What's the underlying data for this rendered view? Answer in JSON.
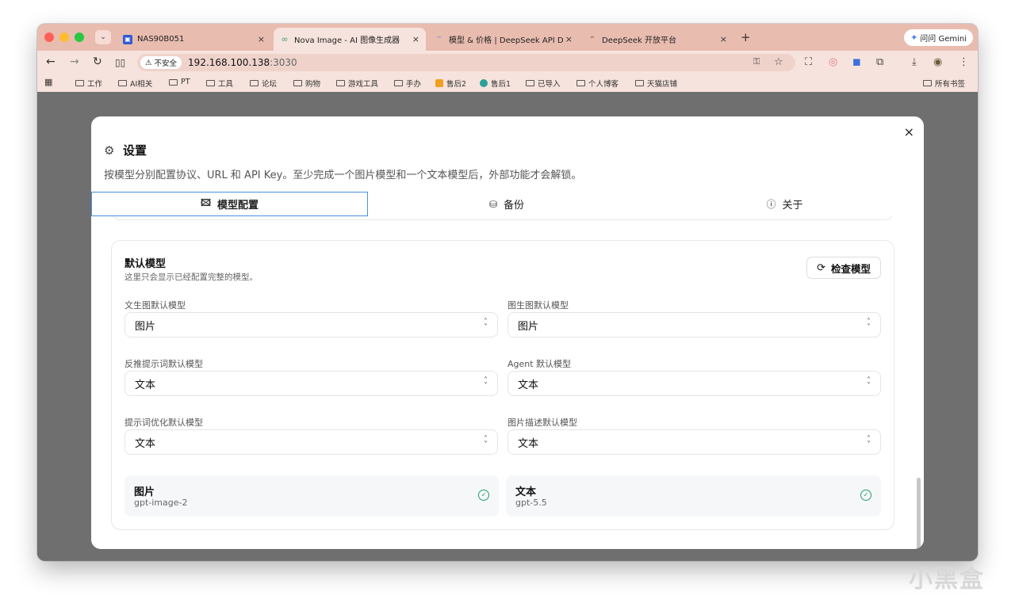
{
  "browser": {
    "tabs": [
      {
        "label": "NAS90B051",
        "color": "#2f5bd3",
        "icon": "nas-icon"
      },
      {
        "label": "Nova Image - AI 图像生成器",
        "color": "#3aa66a",
        "icon": "nova-icon"
      },
      {
        "label": "模型 & 价格 | DeepSeek API D",
        "color": "#4d6bfe",
        "icon": "deepseek-icon"
      },
      {
        "label": "DeepSeek 开放平台",
        "color": "#222222",
        "icon": "deepseek-icon"
      }
    ],
    "new_tab": "+",
    "tab_close": "×",
    "gemini_label": "问问 Gemini",
    "insecure_label": "不安全",
    "url_host": "192.168.100.138",
    "url_port": ":3030",
    "bookmarks": [
      {
        "label": "工作",
        "type": "folder"
      },
      {
        "label": "AI相关",
        "type": "folder"
      },
      {
        "label": "PT",
        "type": "folder"
      },
      {
        "label": "工具",
        "type": "folder"
      },
      {
        "label": "论坛",
        "type": "folder"
      },
      {
        "label": "购物",
        "type": "folder"
      },
      {
        "label": "游戏工具",
        "type": "folder"
      },
      {
        "label": "手办",
        "type": "folder"
      },
      {
        "label": "售后2",
        "type": "link",
        "color": "#f0a020"
      },
      {
        "label": "售后1",
        "type": "link",
        "color": "#2aa198"
      },
      {
        "label": "已导入",
        "type": "folder"
      },
      {
        "label": "个人博客",
        "type": "folder"
      },
      {
        "label": "天猫店铺",
        "type": "folder"
      }
    ],
    "all_bookmarks": "所有书签"
  },
  "dialog": {
    "close": "×",
    "title": "设置",
    "description": "按模型分别配置协议、URL 和 API Key。至少完成一个图片模型和一个文本模型后，外部功能才会解锁。",
    "tabs": [
      {
        "label": "模型配置",
        "icon": "image-icon",
        "active": true
      },
      {
        "label": "备份",
        "icon": "database-icon",
        "active": false
      },
      {
        "label": "关于",
        "icon": "info-icon",
        "active": false
      }
    ],
    "default_models": {
      "title": "默认模型",
      "subtitle": "这里只会显示已经配置完整的模型。",
      "check_button": "检查模型",
      "fields": [
        {
          "label": "文生图默认模型",
          "value": "图片"
        },
        {
          "label": "图生图默认模型",
          "value": "图片"
        },
        {
          "label": "反推提示词默认模型",
          "value": "文本"
        },
        {
          "label": "Agent 默认模型",
          "value": "文本"
        },
        {
          "label": "提示词优化默认模型",
          "value": "文本"
        },
        {
          "label": "图片描述默认模型",
          "value": "文本"
        }
      ],
      "summaries": [
        {
          "name": "图片",
          "model": "gpt-image-2",
          "status": "ok"
        },
        {
          "name": "文本",
          "model": "gpt-5.5",
          "status": "ok"
        }
      ]
    }
  },
  "watermark": "小黑盒"
}
